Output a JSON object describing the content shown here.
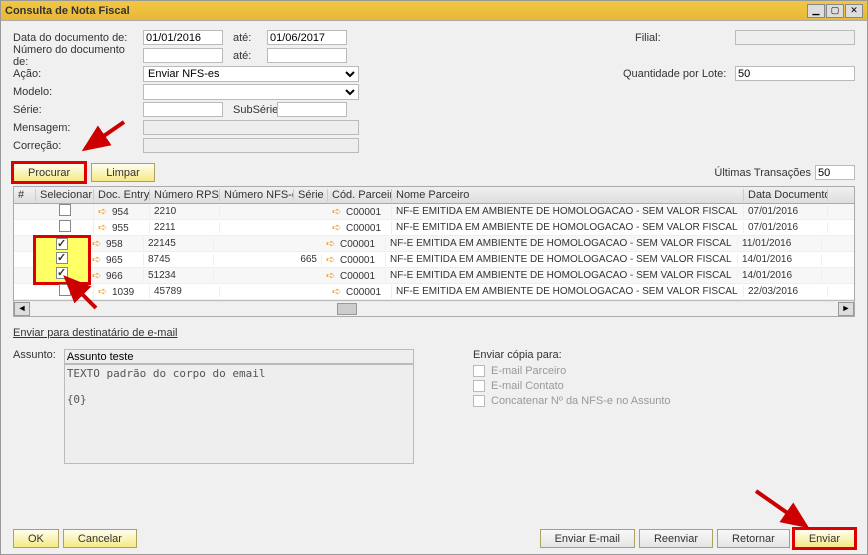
{
  "title": "Consulta de Nota Fiscal",
  "form": {
    "labels": {
      "data_doc": "Data do documento de:",
      "ate": "até:",
      "num_doc": "Número do documento de:",
      "acao": "Ação:",
      "modelo": "Modelo:",
      "serie": "Série:",
      "subserie": "SubSérie:",
      "mensagem": "Mensagem:",
      "correcao": "Correção:",
      "filial": "Filial:",
      "qtd_lote": "Quantidade por Lote:"
    },
    "values": {
      "data_de": "01/01/2016",
      "data_ate": "01/06/2017",
      "num_de": "",
      "num_ate": "",
      "acao": "Enviar NFS-es",
      "modelo": "",
      "serie": "",
      "subserie": "",
      "qtd_lote": "50"
    }
  },
  "buttons": {
    "procurar": "Procurar",
    "limpar": "Limpar",
    "ultimas_label": "Últimas Transações",
    "ultimas_value": "50"
  },
  "table": {
    "headers": {
      "selecionar": "Selecionar",
      "docentry": "Doc. Entry",
      "nrps": "Número RPS",
      "nfse": "Número NFS-e",
      "serie": "Série",
      "codparc": "Cód. Parceiro",
      "nomeparc": "Nome Parceiro",
      "datadoc": "Data Documento"
    },
    "rows": [
      {
        "sel": false,
        "hl": false,
        "docentry": "954",
        "nrps": "2210",
        "nfse": "",
        "serie": "",
        "cp": "C00001",
        "nome": "NF-E EMITIDA EM AMBIENTE DE HOMOLOGACAO - SEM VALOR FISCAL",
        "dd": "07/01/2016"
      },
      {
        "sel": false,
        "hl": false,
        "docentry": "955",
        "nrps": "2211",
        "nfse": "",
        "serie": "",
        "cp": "C00001",
        "nome": "NF-E EMITIDA EM AMBIENTE DE HOMOLOGACAO - SEM VALOR FISCAL",
        "dd": "07/01/2016"
      },
      {
        "sel": true,
        "hl": true,
        "docentry": "958",
        "nrps": "22145",
        "nfse": "",
        "serie": "",
        "cp": "C00001",
        "nome": "NF-E EMITIDA EM AMBIENTE DE HOMOLOGACAO - SEM VALOR FISCAL",
        "dd": "11/01/2016"
      },
      {
        "sel": true,
        "hl": true,
        "docentry": "965",
        "nrps": "8745",
        "nfse": "",
        "serie": "665",
        "cp": "C00001",
        "nome": "NF-E EMITIDA EM AMBIENTE DE HOMOLOGACAO - SEM VALOR FISCAL",
        "dd": "14/01/2016"
      },
      {
        "sel": true,
        "hl": true,
        "docentry": "966",
        "nrps": "51234",
        "nfse": "",
        "serie": "",
        "cp": "C00001",
        "nome": "NF-E EMITIDA EM AMBIENTE DE HOMOLOGACAO - SEM VALOR FISCAL",
        "dd": "14/01/2016"
      },
      {
        "sel": false,
        "hl": false,
        "docentry": "1039",
        "nrps": "45789",
        "nfse": "",
        "serie": "",
        "cp": "C00001",
        "nome": "NF-E EMITIDA EM AMBIENTE DE HOMOLOGACAO - SEM VALOR FISCAL",
        "dd": "22/03/2016"
      }
    ]
  },
  "email": {
    "link": "Enviar para destinatário de e-mail",
    "assunto_label": "Assunto:",
    "assunto_value": "Assunto teste",
    "body": "TEXTO padrão do corpo do email\n\n{0}",
    "copia_label": "Enviar cópia para:",
    "options": {
      "parceiro": "E-mail Parceiro",
      "contato": "E-mail Contato",
      "concat": "Concatenar Nº da NFS-e no Assunto"
    }
  },
  "footer": {
    "ok": "OK",
    "cancelar": "Cancelar",
    "enviar_email": "Enviar E-mail",
    "reenviar": "Reenviar",
    "retornar": "Retornar",
    "enviar": "Enviar"
  }
}
